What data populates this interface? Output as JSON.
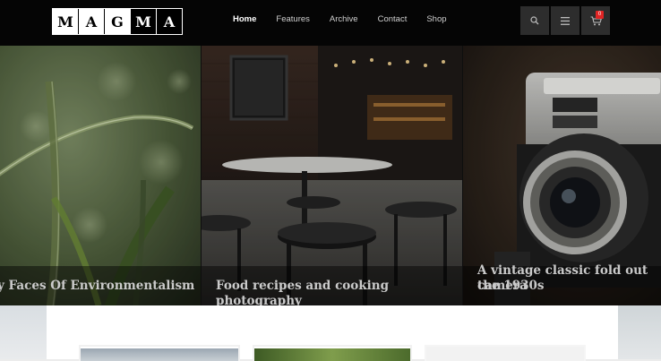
{
  "header": {
    "logo_letters": [
      "M",
      "A",
      "G",
      "M",
      "A"
    ],
    "nav": [
      "Home",
      "Features",
      "Archive",
      "Contact",
      "Shop"
    ],
    "active_nav": "Home",
    "cart_count": "0",
    "icons": [
      "search-icon",
      "menu-icon",
      "cart-icon"
    ]
  },
  "slider": {
    "slides": [
      {
        "caption": "y Faces Of Environmentalism"
      },
      {
        "caption": "Food recipes and cooking photography"
      },
      {
        "caption_line1": "A vintage classic fold out camera",
        "caption_line2": "the 1930s"
      }
    ]
  },
  "colors": {
    "header_bg": "#050505",
    "button_bg": "#2d2d2d",
    "badge": "#e02424"
  }
}
